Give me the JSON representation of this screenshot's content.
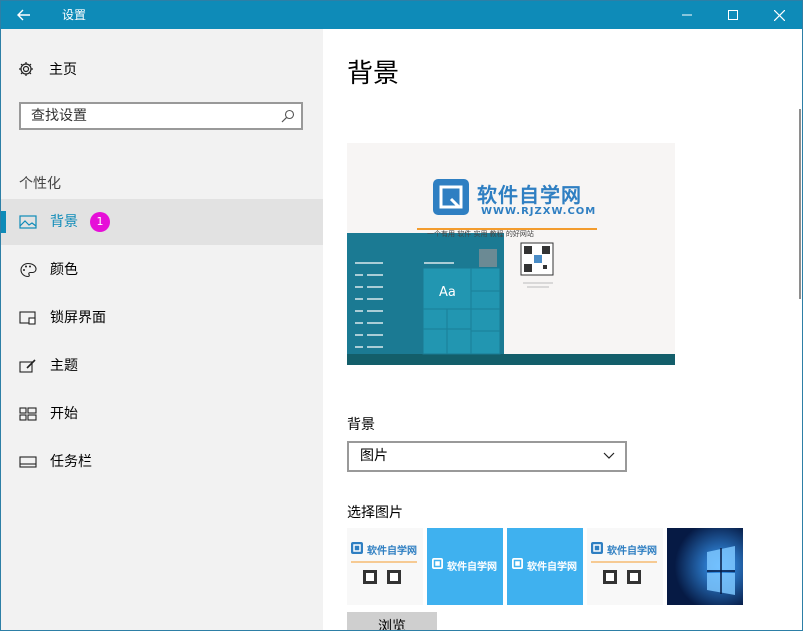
{
  "window": {
    "title": "设置"
  },
  "sidebar": {
    "home_label": "主页",
    "search_placeholder": "查找设置",
    "section_title": "个性化",
    "items": [
      {
        "label": "背景",
        "active": true,
        "badge": "1",
        "icon": "picture-icon"
      },
      {
        "label": "颜色",
        "active": false,
        "icon": "palette-icon"
      },
      {
        "label": "锁屏界面",
        "active": false,
        "icon": "lockscreen-icon"
      },
      {
        "label": "主题",
        "active": false,
        "icon": "theme-icon"
      },
      {
        "label": "开始",
        "active": false,
        "icon": "start-icon"
      },
      {
        "label": "任务栏",
        "active": false,
        "icon": "taskbar-icon"
      }
    ]
  },
  "main": {
    "title": "背景",
    "preview": {
      "brand_name": "软件自学网",
      "brand_url": "WWW.RJZXW.COM",
      "slogan": "一个有用 软件 实用 教程 的好网站",
      "tile_text": "Aa"
    },
    "background_label": "背景",
    "background_value": "图片",
    "choose_label": "选择图片",
    "thumbnails": [
      {
        "type": "light",
        "brand": "软件自学网"
      },
      {
        "type": "blue",
        "brand": "软件自学网"
      },
      {
        "type": "blue",
        "brand": "软件自学网"
      },
      {
        "type": "light",
        "brand": "软件自学网"
      },
      {
        "type": "windows"
      }
    ],
    "browse_label": "浏览"
  },
  "colors": {
    "accent": "#0e8bb8",
    "badge": "#e60fd8",
    "sidebar_bg": "#f2f2f2"
  }
}
